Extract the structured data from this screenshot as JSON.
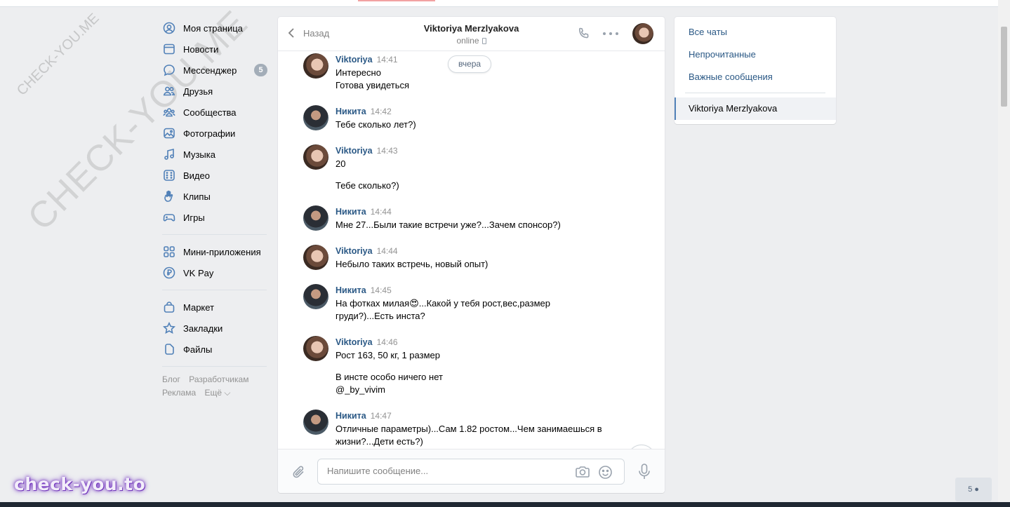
{
  "nav": {
    "items": [
      {
        "label": "Моя страница",
        "icon": "profile-icon"
      },
      {
        "label": "Новости",
        "icon": "news-icon"
      },
      {
        "label": "Мессенджер",
        "icon": "messenger-icon",
        "badge": "5"
      },
      {
        "label": "Друзья",
        "icon": "friends-icon"
      },
      {
        "label": "Сообщества",
        "icon": "communities-icon"
      },
      {
        "label": "Фотографии",
        "icon": "photos-icon"
      },
      {
        "label": "Музыка",
        "icon": "music-icon"
      },
      {
        "label": "Видео",
        "icon": "video-icon"
      },
      {
        "label": "Клипы",
        "icon": "clips-icon"
      },
      {
        "label": "Игры",
        "icon": "games-icon"
      },
      {
        "label": "Мини-приложения",
        "icon": "mini-apps-icon"
      },
      {
        "label": "VK Pay",
        "icon": "vkpay-icon"
      },
      {
        "label": "Маркет",
        "icon": "market-icon"
      },
      {
        "label": "Закладки",
        "icon": "bookmarks-icon"
      },
      {
        "label": "Файлы",
        "icon": "files-icon"
      }
    ],
    "footer": {
      "blog": "Блог",
      "developers": "Разработчикам",
      "ads": "Реклама",
      "more": "Ещё ⌵"
    }
  },
  "chat": {
    "back_label": "Назад",
    "peer_name": "Viktoriya Merzlyakova",
    "peer_status": "online",
    "date_pill": "вчера",
    "messages": [
      {
        "author": "Viktoriya",
        "time": "14:41",
        "lines": [
          "Интересно",
          "Готова увидеться"
        ]
      },
      {
        "author": "Никита",
        "time": "14:42",
        "lines": [
          "Тебе сколько лет?)"
        ]
      },
      {
        "author": "Viktoriya",
        "time": "14:43",
        "lines": [
          "20",
          "Тебе сколько?)"
        ]
      },
      {
        "author": "Никита",
        "time": "14:44",
        "lines": [
          "Мне 27...Были такие встречи уже?...Зачем спонсор?)"
        ]
      },
      {
        "author": "Viktoriya",
        "time": "14:44",
        "lines": [
          "Небыло таких встречь, новый опыт)"
        ]
      },
      {
        "author": "Никита",
        "time": "14:45",
        "lines": [
          "На фотках милая😍...Какой у тебя рост,вес,размер",
          "груди?)...Есть инста?"
        ]
      },
      {
        "author": "Viktoriya",
        "time": "14:46",
        "lines": [
          "Рост 163, 50 кг, 1 размер",
          "В инсте особо ничего нет",
          "@_by_vivim"
        ]
      },
      {
        "author": "Никита",
        "time": "14:47",
        "lines": [
          "Отличные параметры)...Сам 1.82 ростом...Чем занимаешься в",
          "жизни?...Дети есть?)"
        ]
      }
    ],
    "composer_placeholder": "Напишите сообщение..."
  },
  "right_panel": {
    "all_chats": "Все чаты",
    "unread": "Непрочитанные",
    "important": "Важные сообщения",
    "active_chat": "Viktoriya Merzlyakova"
  },
  "watermarks": {
    "small": "CHECK-YOU.ME",
    "big": "CHECK-YOU.ME",
    "logo": "check-you.to"
  },
  "corner_widget": {
    "count": "5"
  },
  "colors": {
    "accent": "#5181b8",
    "link": "#2a5885",
    "background": "#edeef0"
  }
}
